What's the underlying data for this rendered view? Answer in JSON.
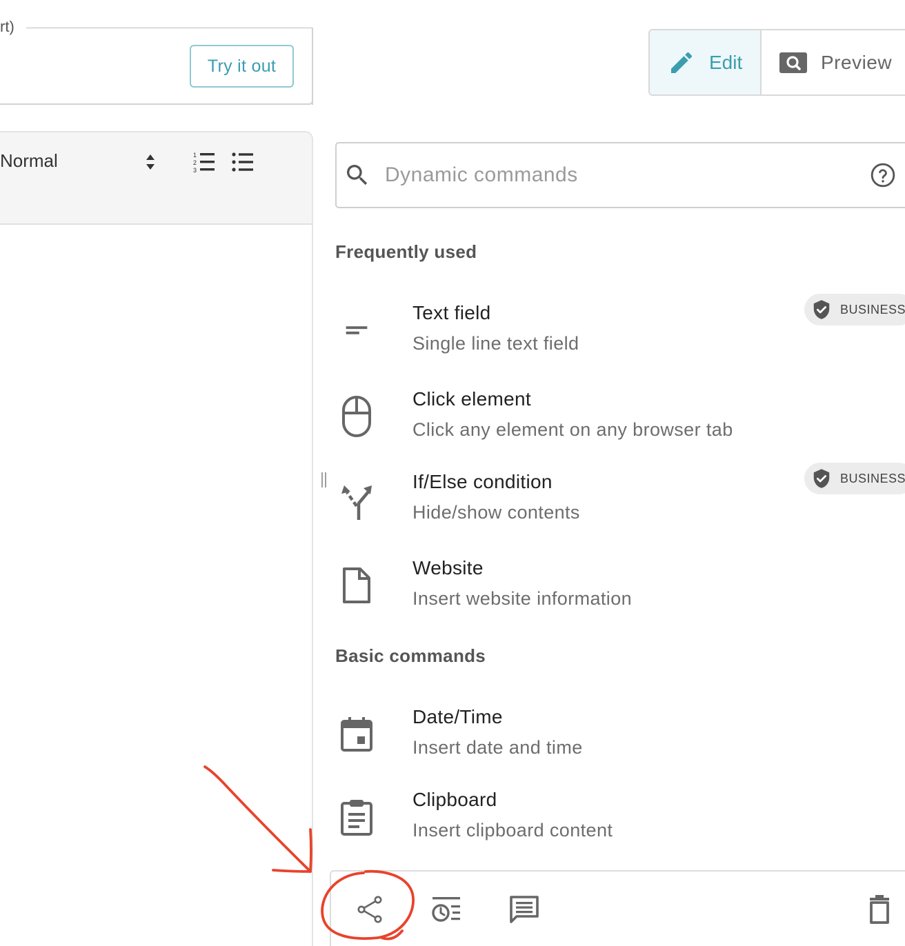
{
  "form": {
    "legend_fragment": "rt)",
    "try_button": "Try it out"
  },
  "editor": {
    "format_select": "Normal"
  },
  "mode_toggle": {
    "edit_label": "Edit",
    "preview_label": "Preview",
    "active": "Edit"
  },
  "search": {
    "placeholder": "Dynamic commands",
    "value": ""
  },
  "sections": {
    "frequent_title": "Frequently used",
    "basic_title": "Basic commands"
  },
  "frequent": [
    {
      "title": "Text field",
      "desc": "Single line text field",
      "icon": "short-text-icon",
      "badge": "BUSINESS"
    },
    {
      "title": "Click element",
      "desc": "Click any element on any browser tab",
      "icon": "mouse-icon",
      "badge": ""
    },
    {
      "title": "If/Else condition",
      "desc": "Hide/show contents",
      "icon": "fork-icon",
      "badge": "BUSINESS"
    },
    {
      "title": "Website",
      "desc": "Insert website information",
      "icon": "file-icon",
      "badge": ""
    }
  ],
  "basic": [
    {
      "title": "Date/Time",
      "desc": "Insert date and time",
      "icon": "calendar-icon"
    },
    {
      "title": "Clipboard",
      "desc": "Insert clipboard content",
      "icon": "clipboard-icon"
    }
  ],
  "bottom_toolbar": [
    "share-icon",
    "history-icon",
    "comment-icon",
    "delete-icon"
  ],
  "colors": {
    "accent": "#3a9db0",
    "annotation": "#e8432b",
    "badge_bg": "#ececec"
  }
}
